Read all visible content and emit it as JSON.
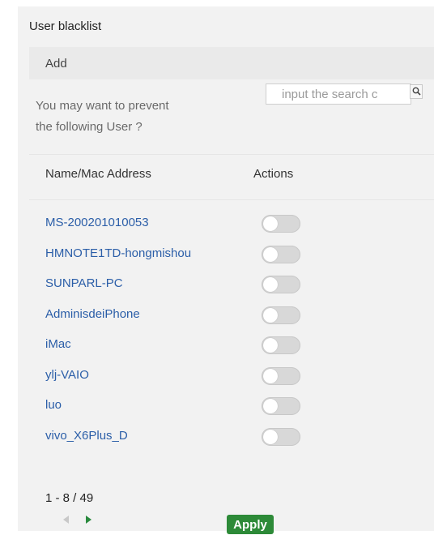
{
  "header": {
    "title": "User blacklist",
    "add_label": "Add"
  },
  "prompt": {
    "line1": "You may want to prevent",
    "line2": "the following User ?"
  },
  "search": {
    "value": "input the search c",
    "icon": "search-icon"
  },
  "table": {
    "columns": [
      "Name/Mac Address",
      "Actions"
    ],
    "rows": [
      {
        "name": "MS-200201010053",
        "enabled": false
      },
      {
        "name": "HMNOTE1TD-hongmishou",
        "enabled": false
      },
      {
        "name": "SUNPARL-PC",
        "enabled": false
      },
      {
        "name": "AdminisdeiPhone",
        "enabled": false
      },
      {
        "name": "iMac",
        "enabled": false
      },
      {
        "name": "ylj-VAIO",
        "enabled": false
      },
      {
        "name": "luo",
        "enabled": false
      },
      {
        "name": "vivo_X6Plus_D",
        "enabled": false
      }
    ]
  },
  "pager": {
    "range": "1 - 8 / 49",
    "prev_icon": "chevron-left-icon",
    "next_icon": "chevron-right-icon"
  },
  "footer": {
    "apply_label": "Apply"
  },
  "colors": {
    "accent": "#2d8a38",
    "link": "#2b5ea8",
    "toggle_off": "#d8d8d8"
  }
}
